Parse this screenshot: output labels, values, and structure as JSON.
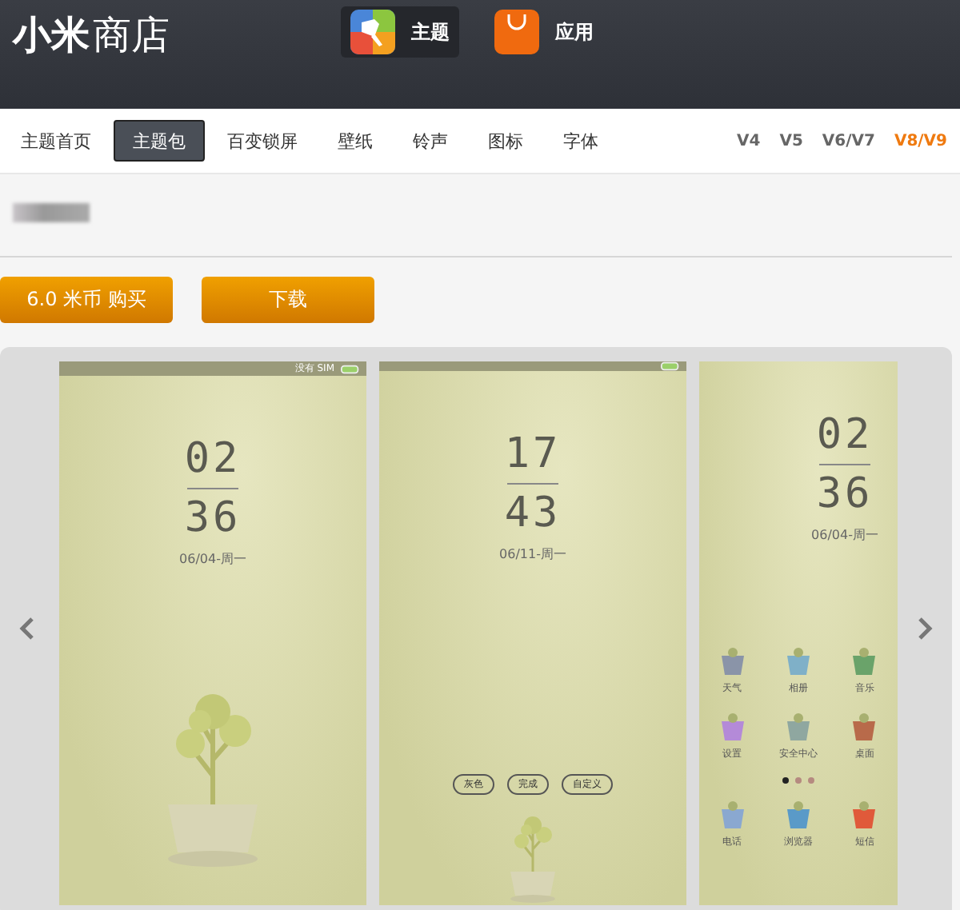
{
  "header": {
    "logo": {
      "bold": "小米",
      "light": "商店"
    },
    "apps": [
      {
        "label": "主题",
        "kind": "theme",
        "selected": true
      },
      {
        "label": "应用",
        "kind": "app",
        "selected": false
      }
    ]
  },
  "nav": {
    "tabs": [
      {
        "label": "主题首页",
        "selected": false
      },
      {
        "label": "主题包",
        "selected": true
      },
      {
        "label": "百变锁屏",
        "selected": false
      },
      {
        "label": "壁纸",
        "selected": false
      },
      {
        "label": "铃声",
        "selected": false
      },
      {
        "label": "图标",
        "selected": false
      },
      {
        "label": "字体",
        "selected": false
      }
    ],
    "versions": [
      {
        "label": "V4",
        "selected": false
      },
      {
        "label": "V5",
        "selected": false
      },
      {
        "label": "V6/V7",
        "selected": false
      },
      {
        "label": "V8/V9",
        "selected": true
      }
    ]
  },
  "product": {
    "buttons": [
      "6.0 米币 购买",
      "下载"
    ]
  },
  "carousel": {
    "screens": [
      {
        "kind": "lockscreen",
        "status_text": "没有 SIM",
        "hour": "02",
        "minute": "36",
        "date": "06/04-周一"
      },
      {
        "kind": "edit",
        "hour": "17",
        "minute": "43",
        "date": "06/11-周一",
        "buttons": [
          "灰色",
          "完成",
          "自定义"
        ]
      },
      {
        "kind": "home",
        "hour": "02",
        "minute": "36",
        "date": "06/04-周一",
        "apps": [
          {
            "label": "天气",
            "color": "#8a94a8"
          },
          {
            "label": "相册",
            "color": "#7fb0c8"
          },
          {
            "label": "音乐",
            "color": "#6aa36a"
          },
          {
            "label": "设置",
            "color": "#b48ad8"
          },
          {
            "label": "安全中心",
            "color": "#8fa7a0"
          },
          {
            "label": "桌面",
            "color": "#b86a4a"
          },
          {
            "label": "电话",
            "color": "#8aa8d0"
          },
          {
            "label": "浏览器",
            "color": "#5a9ac8"
          },
          {
            "label": "短信",
            "color": "#e05a3a"
          }
        ],
        "page_dots": [
          {
            "selected": true
          },
          {
            "selected": false
          },
          {
            "selected": false
          }
        ]
      }
    ]
  }
}
